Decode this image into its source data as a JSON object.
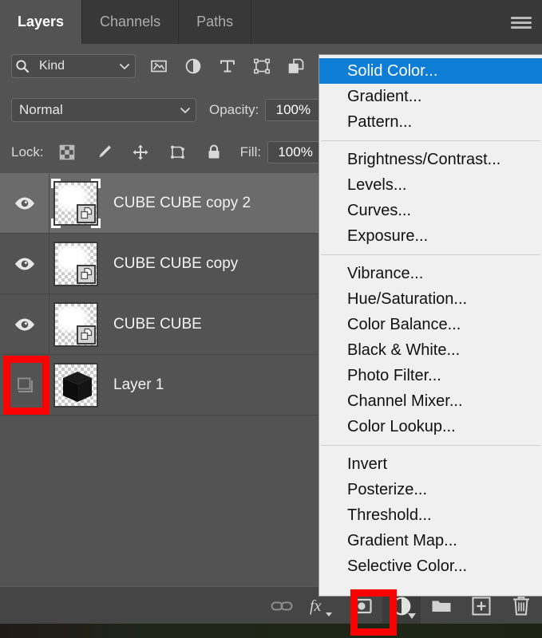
{
  "panel": {
    "tabs": [
      {
        "label": "Layers",
        "active": true
      },
      {
        "label": "Channels",
        "active": false
      },
      {
        "label": "Paths",
        "active": false
      }
    ],
    "menu_icon": "hamburger-menu-icon"
  },
  "filter_row": {
    "search_icon": "search-icon",
    "kind_value": "Kind",
    "chevron_icon": "chevron-down-icon",
    "filter_icons": [
      {
        "name": "pixel-layers-filter-icon"
      },
      {
        "name": "adjustment-layers-filter-icon"
      },
      {
        "name": "type-layers-filter-icon"
      },
      {
        "name": "shape-layers-filter-icon"
      },
      {
        "name": "smart-object-filter-icon"
      }
    ]
  },
  "blend_row": {
    "blend_mode": "Normal",
    "chevron_icon": "chevron-down-icon",
    "opacity_label": "Opacity:",
    "opacity_value": "100%"
  },
  "lock_row": {
    "lock_label": "Lock:",
    "lock_icons": [
      {
        "name": "lock-transparent-pixels-icon"
      },
      {
        "name": "lock-image-pixels-icon"
      },
      {
        "name": "lock-position-icon"
      },
      {
        "name": "lock-artboard-nesting-icon"
      },
      {
        "name": "lock-all-icon"
      }
    ],
    "fill_label": "Fill:",
    "fill_value": "100%"
  },
  "layers": [
    {
      "name": "CUBE CUBE copy 2",
      "visible": true,
      "selected": true,
      "thumb": "smart-object-cloud-thumbnail",
      "badge": "smart-object-badge"
    },
    {
      "name": "CUBE CUBE copy",
      "visible": true,
      "selected": false,
      "thumb": "smart-object-cloud-thumbnail",
      "badge": "smart-object-badge"
    },
    {
      "name": "CUBE CUBE",
      "visible": true,
      "selected": false,
      "thumb": "smart-object-cloud-thumbnail",
      "badge": "smart-object-badge"
    },
    {
      "name": "Layer 1",
      "visible": false,
      "selected": false,
      "thumb": "black-cube-thumbnail",
      "badge": null
    }
  ],
  "bottom_toolbar": [
    {
      "name": "link-layers-button",
      "icon": "link-icon",
      "active": false
    },
    {
      "name": "layer-style-button",
      "icon": "fx-icon",
      "active": false
    },
    {
      "name": "add-layer-mask-button",
      "icon": "layer-mask-icon",
      "active": false
    },
    {
      "name": "new-adjustment-layer-button",
      "icon": "half-filled-circle-icon",
      "active": true
    },
    {
      "name": "new-group-button",
      "icon": "folder-icon",
      "active": false
    },
    {
      "name": "new-layer-button",
      "icon": "plus-square-icon",
      "active": false
    },
    {
      "name": "delete-layer-button",
      "icon": "trash-icon",
      "active": false
    }
  ],
  "adjustment_menu": {
    "groups": [
      {
        "items": [
          {
            "label": "Solid Color...",
            "highlight": true
          },
          {
            "label": "Gradient...",
            "highlight": false
          },
          {
            "label": "Pattern...",
            "highlight": false
          }
        ]
      },
      {
        "items": [
          {
            "label": "Brightness/Contrast...",
            "highlight": false
          },
          {
            "label": "Levels...",
            "highlight": false
          },
          {
            "label": "Curves...",
            "highlight": false
          },
          {
            "label": "Exposure...",
            "highlight": false
          }
        ]
      },
      {
        "items": [
          {
            "label": "Vibrance...",
            "highlight": false
          },
          {
            "label": "Hue/Saturation...",
            "highlight": false
          },
          {
            "label": "Color Balance...",
            "highlight": false
          },
          {
            "label": "Black & White...",
            "highlight": false
          },
          {
            "label": "Photo Filter...",
            "highlight": false
          },
          {
            "label": "Channel Mixer...",
            "highlight": false
          },
          {
            "label": "Color Lookup...",
            "highlight": false
          }
        ]
      },
      {
        "items": [
          {
            "label": "Invert",
            "highlight": false
          },
          {
            "label": "Posterize...",
            "highlight": false
          },
          {
            "label": "Threshold...",
            "highlight": false
          },
          {
            "label": "Gradient Map...",
            "highlight": false
          },
          {
            "label": "Selective Color...",
            "highlight": false
          }
        ]
      }
    ]
  },
  "annotations": {
    "highlight_color": "#ff0000",
    "boxes": [
      {
        "name": "layer-1-visibility-highlight"
      },
      {
        "name": "new-adjustment-layer-highlight"
      }
    ]
  }
}
